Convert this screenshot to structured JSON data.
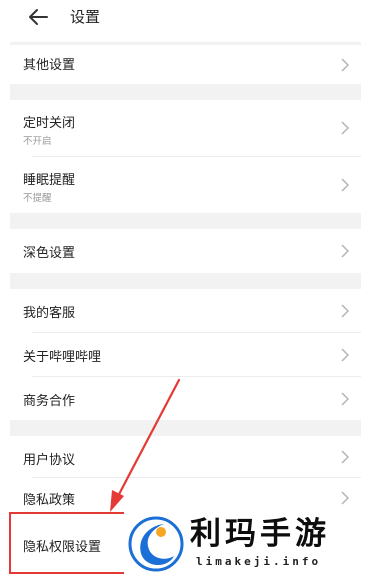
{
  "header": {
    "back_icon": "arrow-left-icon",
    "title": "设置"
  },
  "settings": [
    {
      "label": "其他设置",
      "sub": ""
    },
    {
      "label": "定时关闭",
      "sub": "不开启"
    },
    {
      "label": "睡眠提醒",
      "sub": "不提醒"
    },
    {
      "label": "深色设置",
      "sub": ""
    },
    {
      "label": "我的客服",
      "sub": ""
    },
    {
      "label": "关于哔哩哔哩",
      "sub": ""
    },
    {
      "label": "商务合作",
      "sub": ""
    },
    {
      "label": "用户协议",
      "sub": ""
    },
    {
      "label": "隐私政策",
      "sub": ""
    },
    {
      "label": "隐私权限设置",
      "sub": ""
    }
  ],
  "annotation": {
    "color": "#e53935",
    "highlighted_item": "隐私权限设置"
  },
  "watermark": {
    "name": "利玛手游",
    "url": "limakeji.info"
  }
}
